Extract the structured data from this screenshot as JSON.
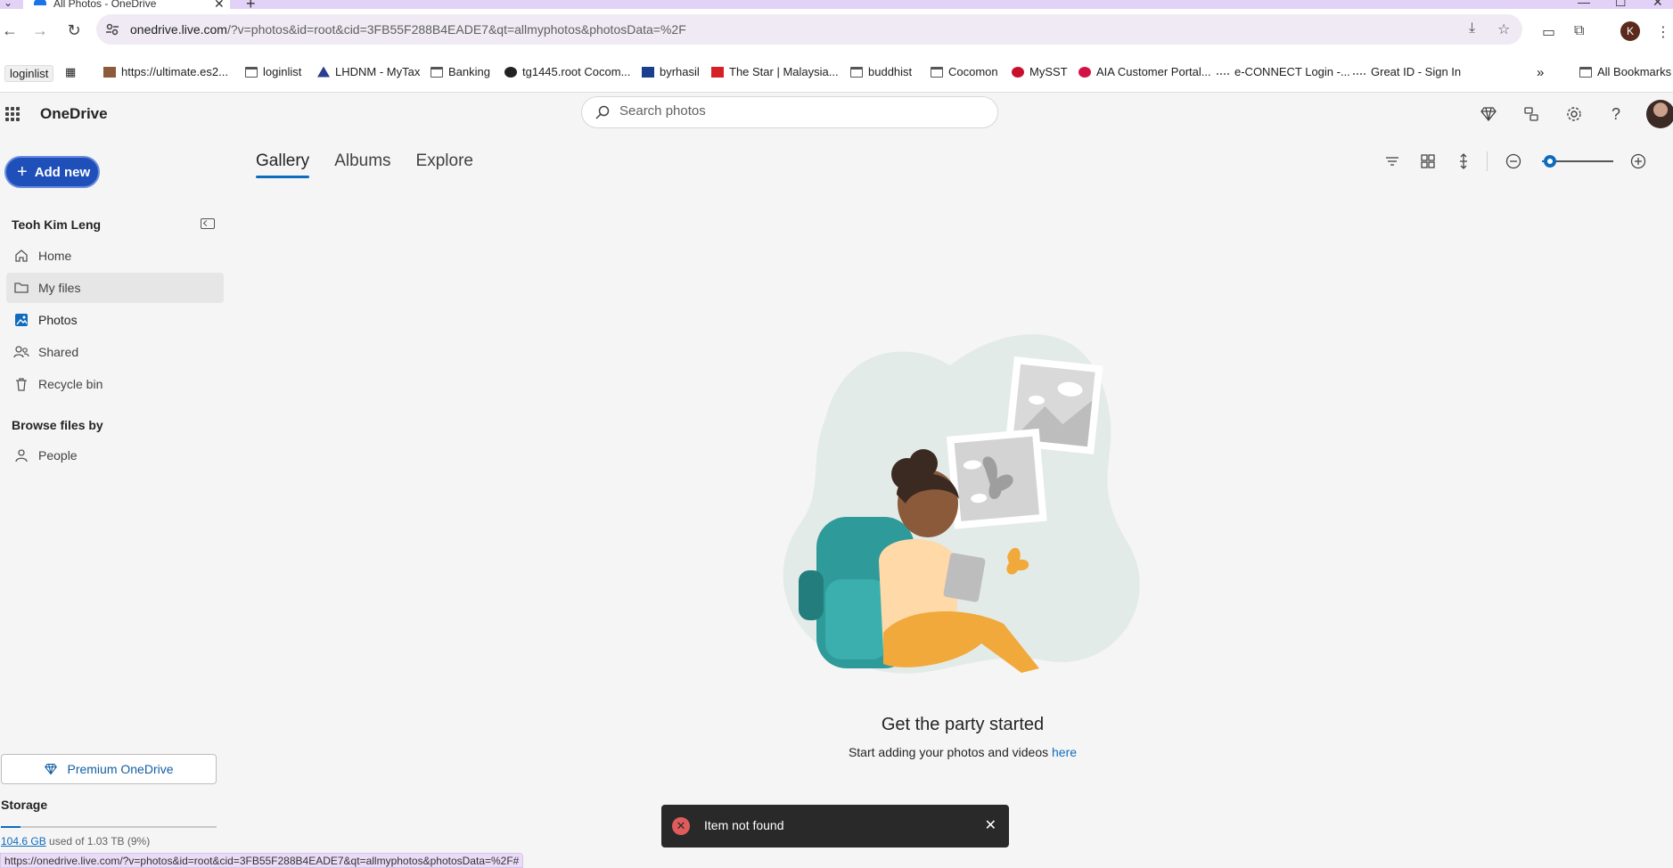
{
  "browser": {
    "tab_title": "All Photos - OneDrive",
    "url_host": "onedrive.live.com",
    "url_path": "/?v=photos&id=root&cid=3FB55F288B4EADE7&qt=allmyphotos&photosData=%2F",
    "profile_initial": "K",
    "status_url": "https://onedrive.live.com/?v=photos&id=root&cid=3FB55F288B4EADE7&qt=allmyphotos&photosData=%2F#",
    "bookmarks": [
      "loginlist",
      "https://ultimate.es2...",
      "loginlist",
      "LHDNM - MyTax",
      "Banking",
      "tg1445.root Cocom...",
      "byrhasil",
      "The Star | Malaysia...",
      "buddhist",
      "Cocomon",
      "MySST",
      "AIA Customer Portal...",
      "e-CONNECT Login -...",
      "Great ID - Sign In"
    ],
    "all_bookmarks": "All Bookmarks"
  },
  "app": {
    "brand": "OneDrive",
    "search_placeholder": "Search photos"
  },
  "sidebar": {
    "add_new": "Add new",
    "user_name": "Teoh Kim Leng",
    "items": [
      {
        "label": "Home"
      },
      {
        "label": "My files"
      },
      {
        "label": "Photos"
      },
      {
        "label": "Shared"
      },
      {
        "label": "Recycle bin"
      }
    ],
    "browse_title": "Browse files by",
    "browse_items": [
      {
        "label": "People"
      }
    ],
    "premium": "Premium OneDrive",
    "storage_title": "Storage",
    "storage_used": "104.6 GB",
    "storage_rest": " used of 1.03 TB (9%)",
    "storage_fraction": 0.09
  },
  "main": {
    "tabs": [
      {
        "label": "Gallery",
        "selected": true
      },
      {
        "label": "Albums"
      },
      {
        "label": "Explore"
      }
    ],
    "empty_title": "Get the party started",
    "empty_sub": "Start adding your photos and videos ",
    "empty_link": "here"
  },
  "toast": {
    "message": "Item not found"
  },
  "colors": {
    "accent": "#0f6cbd",
    "add_button": "#1f4fb8",
    "toast_bg": "#292929",
    "error": "#e05c5c"
  }
}
